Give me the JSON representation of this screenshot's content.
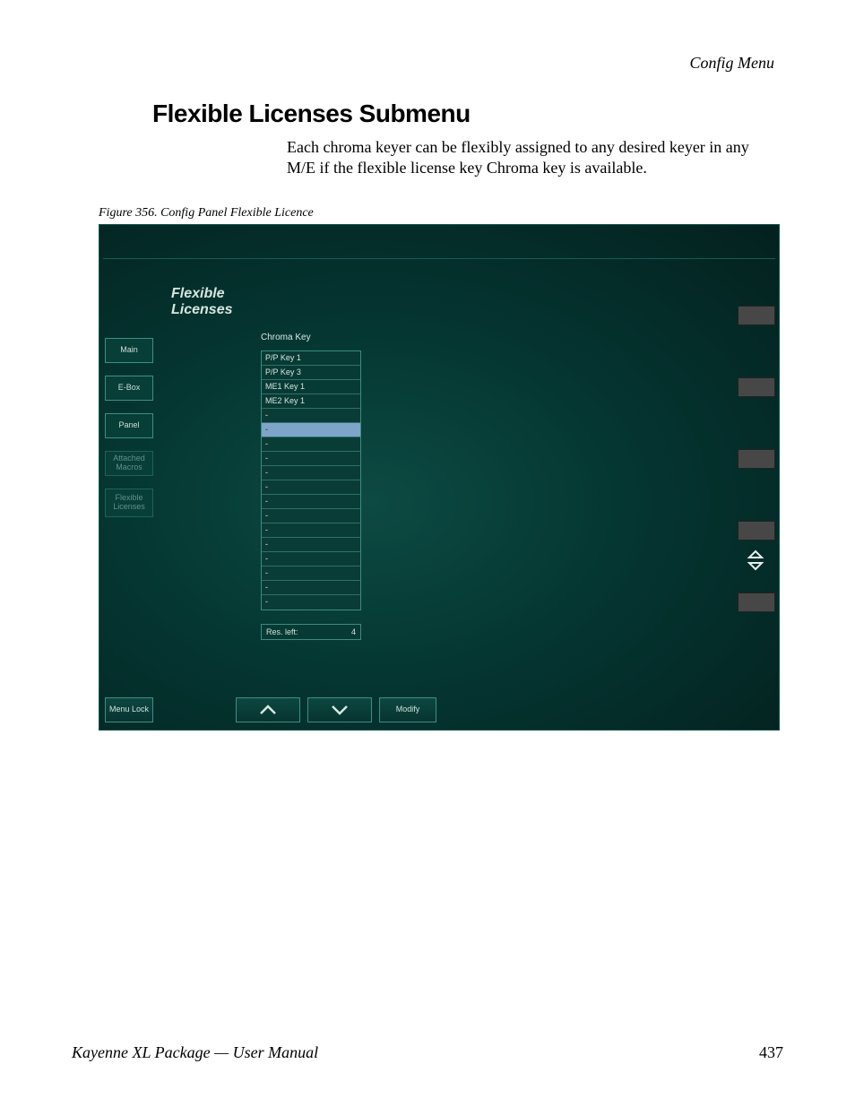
{
  "header": {
    "breadcrumb": "Config Menu"
  },
  "section": {
    "title": "Flexible Licenses Submenu",
    "intro": "Each chroma keyer can be flexibly assigned to any desired keyer in any M/E if the flexible license key Chroma key is available."
  },
  "figure": {
    "caption": "Figure 356.  Config Panel Flexible Licence"
  },
  "panel": {
    "title_line1": "Flexible",
    "title_line2": "Licenses",
    "tabs": {
      "main": "Main",
      "ebox": "E-Box",
      "panel": "Panel",
      "attached_macros": "Attached Macros",
      "flexible_licenses": "Flexible Licenses"
    },
    "column_header": "Chroma Key",
    "list": [
      "P/P Key 1",
      "P/P Key 3",
      "ME1 Key 1",
      "ME2 Key 1",
      "-",
      "-",
      "-",
      "-",
      "-",
      "-",
      "-",
      "-",
      "-",
      "-",
      "-",
      "-",
      "-",
      "-"
    ],
    "selected_index": 5,
    "res_left_label": "Res. left:",
    "res_left_value": "4",
    "bottom": {
      "menu_lock": "Menu Lock",
      "up": "⌃",
      "down": "⌄",
      "modify": "Modify"
    }
  },
  "footer": {
    "left": "Kayenne XL Package — User Manual",
    "page": "437"
  }
}
